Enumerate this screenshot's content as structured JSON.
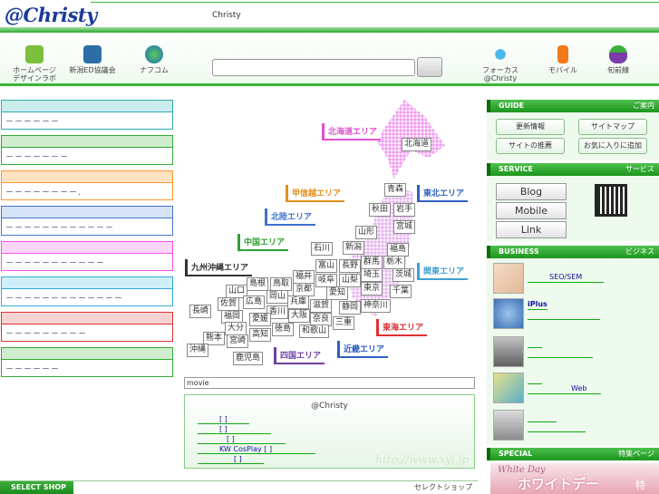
{
  "header": {
    "logo_text": "@Christy",
    "site_title": "Christy"
  },
  "nav": {
    "items": [
      {
        "label": "ホームページ\nデザインラボ",
        "icon": "leaf-icon"
      },
      {
        "label": "新潟ED協議会",
        "icon": "cube-icon"
      },
      {
        "label": "ナフコム",
        "icon": "globe-icon"
      },
      {
        "label": "フォーカス\n@Christy",
        "icon": "pin-icon"
      },
      {
        "label": "モバイル",
        "icon": "mobile-phone-icon"
      },
      {
        "label": "旬前線",
        "icon": "vegetable-icon"
      }
    ],
    "search_value": ""
  },
  "left_boxes": [
    {
      "text": "－－－－－－",
      "color": "#3aa",
      "bg": "#c9ecec"
    },
    {
      "text": "－－－－－－－",
      "color": "#3a3",
      "bg": "#cfeccf"
    },
    {
      "text": "－－－－－－－－.",
      "color": "#f93",
      "bg": "#ffe2c2"
    },
    {
      "text": "－－－－－－－－－－－－",
      "color": "#47c",
      "bg": "#d6e2f6"
    },
    {
      "text": "－－－－－－－－－－－",
      "color": "#e5e",
      "bg": "#fcd6fc"
    },
    {
      "text": "－－－－－－－－－－－－－",
      "color": "#3ad",
      "bg": "#cfeff9"
    },
    {
      "text": "－－－－－－－－－",
      "color": "#d33",
      "bg": "#f7d4d4"
    },
    {
      "text": "－－－－－－",
      "color": "#3a3",
      "bg": "#cfeccf"
    }
  ],
  "map": {
    "areas": [
      {
        "name": "北海道エリア",
        "color": "#e050d0"
      },
      {
        "name": "東北エリア",
        "color": "#3060c0"
      },
      {
        "name": "甲信越エリア",
        "color": "#e09020"
      },
      {
        "name": "北陸エリア",
        "color": "#4070d0"
      },
      {
        "name": "中国エリア",
        "color": "#30a030"
      },
      {
        "name": "九州沖縄エリア",
        "color": "#333333"
      },
      {
        "name": "関東エリア",
        "color": "#40a0d0"
      },
      {
        "name": "東海エリア",
        "color": "#e03030"
      },
      {
        "name": "近畿エリア",
        "color": "#3060c0"
      },
      {
        "name": "四国エリア",
        "color": "#7040a0"
      }
    ],
    "prefectures": [
      "北海道",
      "青森",
      "秋田",
      "岩手",
      "宮城",
      "山形",
      "福島",
      "新潟",
      "石川",
      "富山",
      "長野",
      "群馬",
      "栃木",
      "茨城",
      "埼玉",
      "福井",
      "岐阜",
      "山梨",
      "東京",
      "千葉",
      "京都",
      "愛知",
      "神奈川",
      "鳥取",
      "島根",
      "兵庫",
      "滋賀",
      "静岡",
      "山口",
      "岡山",
      "広島",
      "佐賀",
      "福岡",
      "長崎",
      "香川",
      "大阪",
      "奈良",
      "三重",
      "大分",
      "熊本",
      "高知",
      "宮崎",
      "徳島",
      "和歌山",
      "愛媛",
      "沖縄",
      "鹿児島"
    ]
  },
  "movie": {
    "label": "movie"
  },
  "info": {
    "title": "@Christy",
    "lines": [
      "　　　[ ]　　　",
      "　　　[ ]　　　　　　",
      "　　　　[ ]　　　　　　　",
      "　　　KW CosPlay [ ]　　　　　　",
      "　　　　　[ ]　　　"
    ],
    "url_watermark": "http://www.xyj.jp"
  },
  "right": {
    "guide": {
      "title": "GUIDE",
      "jp": "ご案内",
      "buttons": [
        "更新情報",
        "サイトマップ",
        "サイトの推薦",
        "お気に入りに追加"
      ]
    },
    "service": {
      "title": "SERVICE",
      "jp": "サービス",
      "buttons": [
        "Blog",
        "Mobile",
        "Link"
      ]
    },
    "business": {
      "title": "BUSINESS",
      "jp": "ビジネス",
      "items": [
        {
          "text": "　　　SEO/SEM　　　",
          "sub": ""
        },
        {
          "text": "iPlus",
          "sub": "　　　　　　　　　　"
        },
        {
          "text": "　　",
          "sub": "　　　　　　　　　"
        },
        {
          "text": "　　",
          "sub": "　　　　　　Web　　"
        },
        {
          "text": "　　　　",
          "sub": "　　　　　　　　"
        }
      ]
    },
    "special": {
      "title": "SPECIAL",
      "jp": "特集ページ",
      "banner_main": "ホワイトデー",
      "banner_script": "White Day",
      "banner_tail": "特"
    }
  },
  "select_shop": {
    "left": "SELECT SHOP",
    "right": "セレクトショップ"
  }
}
